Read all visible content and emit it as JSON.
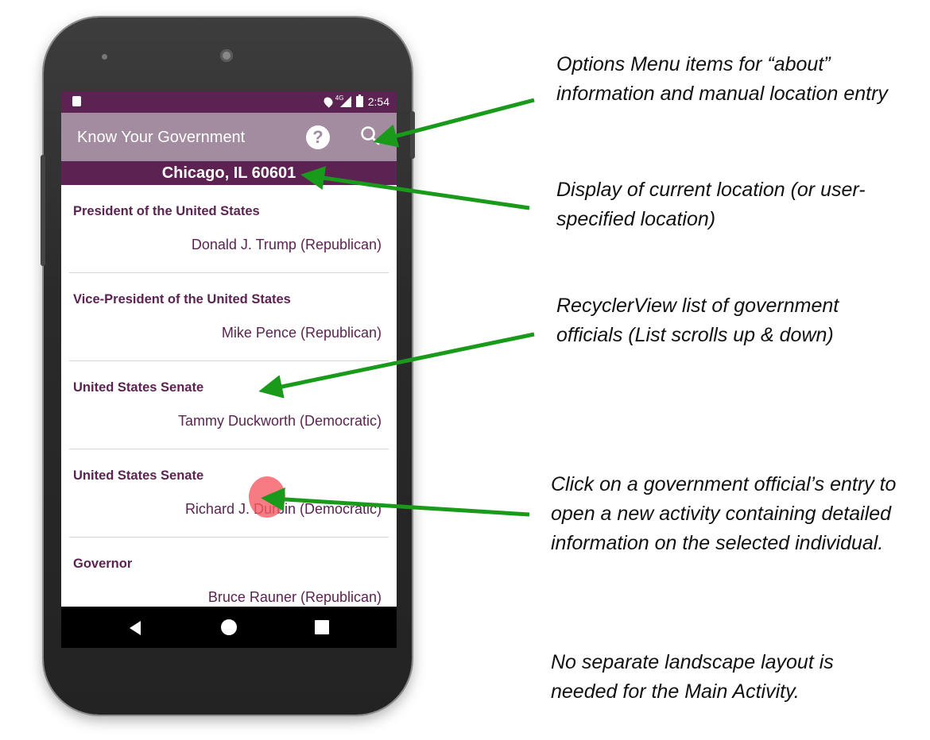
{
  "status_bar": {
    "time": "2:54",
    "network": "4G"
  },
  "app_bar": {
    "title": "Know Your Government",
    "help_icon": "help-icon",
    "search_icon": "search-icon"
  },
  "location": "Chicago, IL 60601",
  "officials": [
    {
      "office": "President of the United States",
      "official": "Donald J. Trump (Republican)"
    },
    {
      "office": "Vice-President of the United States",
      "official": "Mike Pence (Republican)"
    },
    {
      "office": "United States Senate",
      "official": "Tammy Duckworth (Democratic)"
    },
    {
      "office": "United States Senate",
      "official": "Richard J. Durbin (Democratic)"
    },
    {
      "office": "Governor",
      "official": "Bruce Rauner (Republican)"
    }
  ],
  "annotations": {
    "options_menu": "Options Menu items for “about” information and manual location entry",
    "location_display": "Display of current location (or user-specified location)",
    "recycler": "RecyclerView list of government officials (List scrolls up & down)",
    "click": "Click on a government official’s entry to open a new activity containing detailed information on the selected individual.",
    "landscape": "No separate landscape layout is needed for the Main Activity."
  },
  "colors": {
    "primary_dark": "#5c2352",
    "primary": "#a38ba0",
    "arrow": "#1a9a1a",
    "touch": "#f55a64"
  }
}
